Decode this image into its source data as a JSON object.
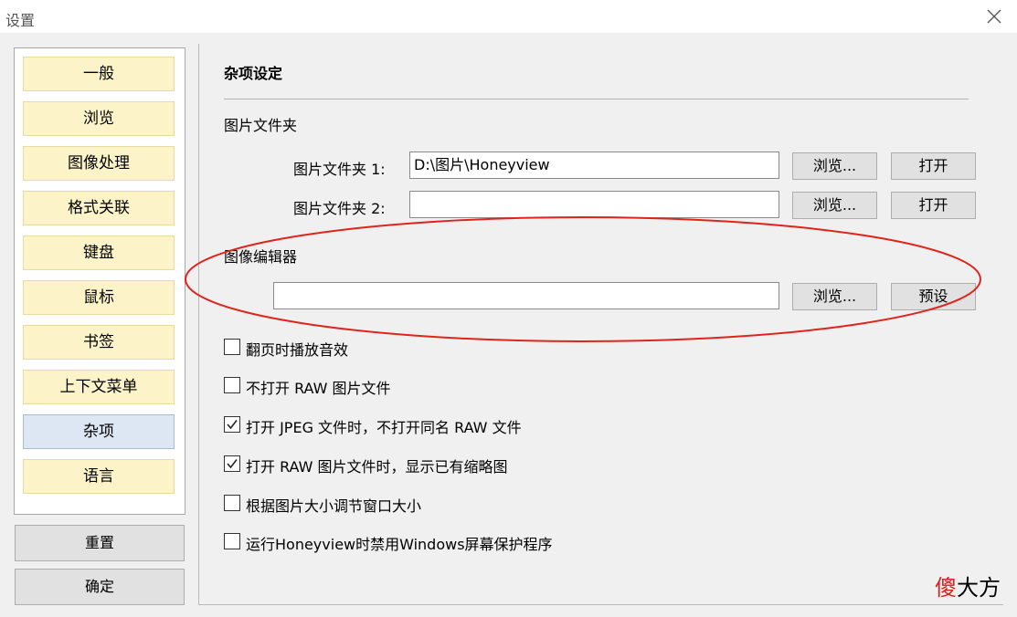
{
  "window": {
    "title": "设置"
  },
  "sidebar": {
    "items": [
      {
        "label": "一般"
      },
      {
        "label": "浏览"
      },
      {
        "label": "图像处理"
      },
      {
        "label": "格式关联"
      },
      {
        "label": "键盘"
      },
      {
        "label": "鼠标"
      },
      {
        "label": "书签"
      },
      {
        "label": "上下文菜单"
      },
      {
        "label": "杂项",
        "active": true
      },
      {
        "label": "语言"
      }
    ],
    "reset_label": "重置",
    "ok_label": "确定"
  },
  "main": {
    "section_title": "杂项设定",
    "image_folder": {
      "heading": "图片文件夹",
      "folder1_label": "图片文件夹 1:",
      "folder1_value": "D:\\图片\\Honeyview",
      "folder2_label": "图片文件夹 2:",
      "folder2_value": "",
      "browse_label": "浏览...",
      "open_label": "打开"
    },
    "image_editor": {
      "heading": "图像编辑器",
      "value": "",
      "browse_label": "浏览...",
      "preset_label": "预设"
    },
    "options": [
      {
        "label": "翻页时播放音效",
        "checked": false
      },
      {
        "label": "不打开 RAW 图片文件",
        "checked": false
      },
      {
        "label": "打开 JPEG 文件时，不打开同名 RAW 文件",
        "checked": true
      },
      {
        "label": "打开 RAW 图片文件时，显示已有缩略图",
        "checked": true
      },
      {
        "label": "根据图片大小调节窗口大小",
        "checked": false
      },
      {
        "label": "运行Honeyview时禁用Windows屏幕保护程序",
        "checked": false
      }
    ]
  },
  "watermark": {
    "char1": "傻",
    "rest": "大方"
  },
  "colors": {
    "highlight_ellipse": "#e0241b",
    "nav_item_bg": "#fcf4c8",
    "nav_active_bg": "#dde7f4"
  }
}
